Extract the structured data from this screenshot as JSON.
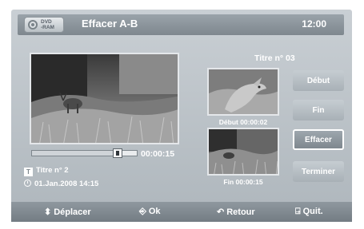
{
  "header": {
    "disc_line1": "DVD",
    "disc_line2": "-RAM",
    "title": "Effacer A-B",
    "time": "12:00"
  },
  "player": {
    "progress": 0.82,
    "current_time": "00:00:15",
    "title_info": "Titre n° 2",
    "date_info": "01.Jan.2008  14:15"
  },
  "markers": {
    "title": "Titre n° 03",
    "start_caption": "Début 00:00:02",
    "end_caption": "Fin 00:00:15"
  },
  "buttons": {
    "start": "Début",
    "end": "Fin",
    "delete": "Effacer",
    "finish": "Terminer"
  },
  "footer": {
    "move": "Déplacer",
    "ok": "Ok",
    "back": "Retour",
    "quit": "Quit."
  },
  "icons": {
    "disc": "disc-icon",
    "title": "title-icon",
    "clock": "clock-icon",
    "move": "up-down-arrows-icon",
    "ok": "enter-icon",
    "back": "return-arrow-icon",
    "quit": "exit-icon"
  },
  "colors": {
    "panel": "#aeb6bc",
    "title_bar": "#7e878e",
    "button": "#a8b0b6",
    "active_button_border": "#ffffff"
  }
}
